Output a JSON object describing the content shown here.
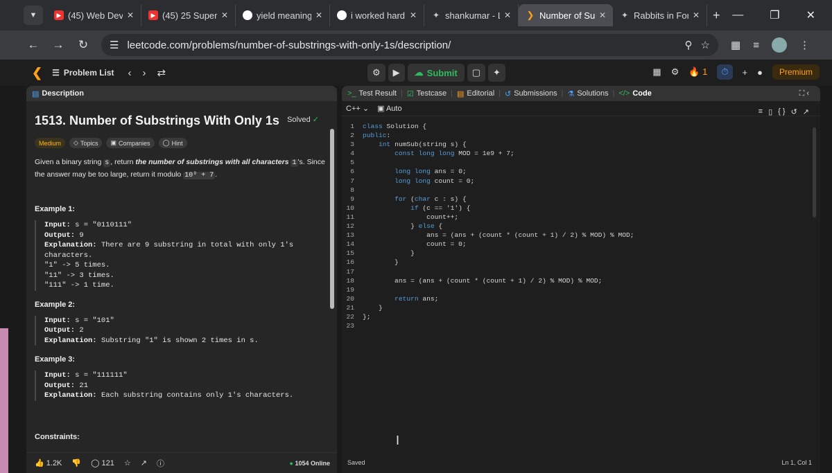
{
  "browser": {
    "tabs": [
      {
        "title": "(45) Web Dev",
        "icon": "youtube-icon"
      },
      {
        "title": "(45) 25 Super",
        "icon": "youtube-icon"
      },
      {
        "title": "yield meaning",
        "icon": "google-icon"
      },
      {
        "title": "i worked hard",
        "icon": "google-icon"
      },
      {
        "title": "shankumar - L",
        "icon": "gemini-icon"
      },
      {
        "title": "Number of Su",
        "icon": "leetcode-icon",
        "active": true
      },
      {
        "title": "Rabbits in For",
        "icon": "gemini-icon"
      }
    ],
    "url": "leetcode.com/problems/number-of-substrings-with-only-1s/description/"
  },
  "lc_header": {
    "problem_list": "Problem List",
    "submit": "Submit",
    "streak": "1",
    "premium": "Premium"
  },
  "left_tabs": {
    "description": "Description"
  },
  "problem": {
    "title": "1513. Number of Substrings With Only 1s",
    "solved": "Solved",
    "tags": [
      "Medium",
      "Topics",
      "Companies",
      "Hint"
    ],
    "statement_pre": "Given a binary string",
    "statement_var": "s",
    "statement_mid": ", return",
    "statement_em": "the number of substrings with all characters",
    "statement_one": "1",
    "statement_post": "'s. Since the answer may be too large, return it modulo",
    "statement_mod": "10⁹ + 7",
    "statement_end": ".",
    "examples": [
      {
        "title": "Example 1:",
        "input": "s = \"0110111\"",
        "output": "9",
        "explanation": "There are 9 substring in total with only 1's\ncharacters.\n\"1\" -> 5 times.\n\"11\" -> 3 times.\n\"111\" -> 1 time."
      },
      {
        "title": "Example 2:",
        "input": "s = \"101\"",
        "output": "2",
        "explanation": "Substring \"1\" is shown 2 times in s."
      },
      {
        "title": "Example 3:",
        "input": "s = \"111111\"",
        "output": "21",
        "explanation": "Each substring contains only 1's characters."
      }
    ],
    "labels": {
      "input": "Input:",
      "output": "Output:",
      "explanation": "Explanation:"
    },
    "constraints": "Constraints:",
    "likes": "1.2K",
    "comments": "121",
    "online": "1054 Online"
  },
  "right_tabs": [
    "Test Result",
    "Testcase",
    "Editorial",
    "Submissions",
    "Solutions",
    "Code"
  ],
  "editor": {
    "language": "C++",
    "mode": "Auto",
    "status": "Saved",
    "cursor_pos": "Ln 1, Col 1",
    "lines": [
      "class Solution {",
      "public:",
      "    int numSub(string s) {",
      "        const long long MOD = 1e9 + 7;",
      "",
      "        long long ans = 0;",
      "        long long count = 0;",
      "",
      "        for (char c : s) {",
      "            if (c == '1') {",
      "                count++;",
      "            } else {",
      "                ans = (ans + (count * (count + 1) / 2) % MOD) % MOD;",
      "                count = 0;",
      "            }",
      "        }",
      "",
      "        ans = (ans + (count * (count + 1) / 2) % MOD) % MOD;",
      "",
      "        return ans;",
      "    }",
      "};",
      ""
    ]
  }
}
